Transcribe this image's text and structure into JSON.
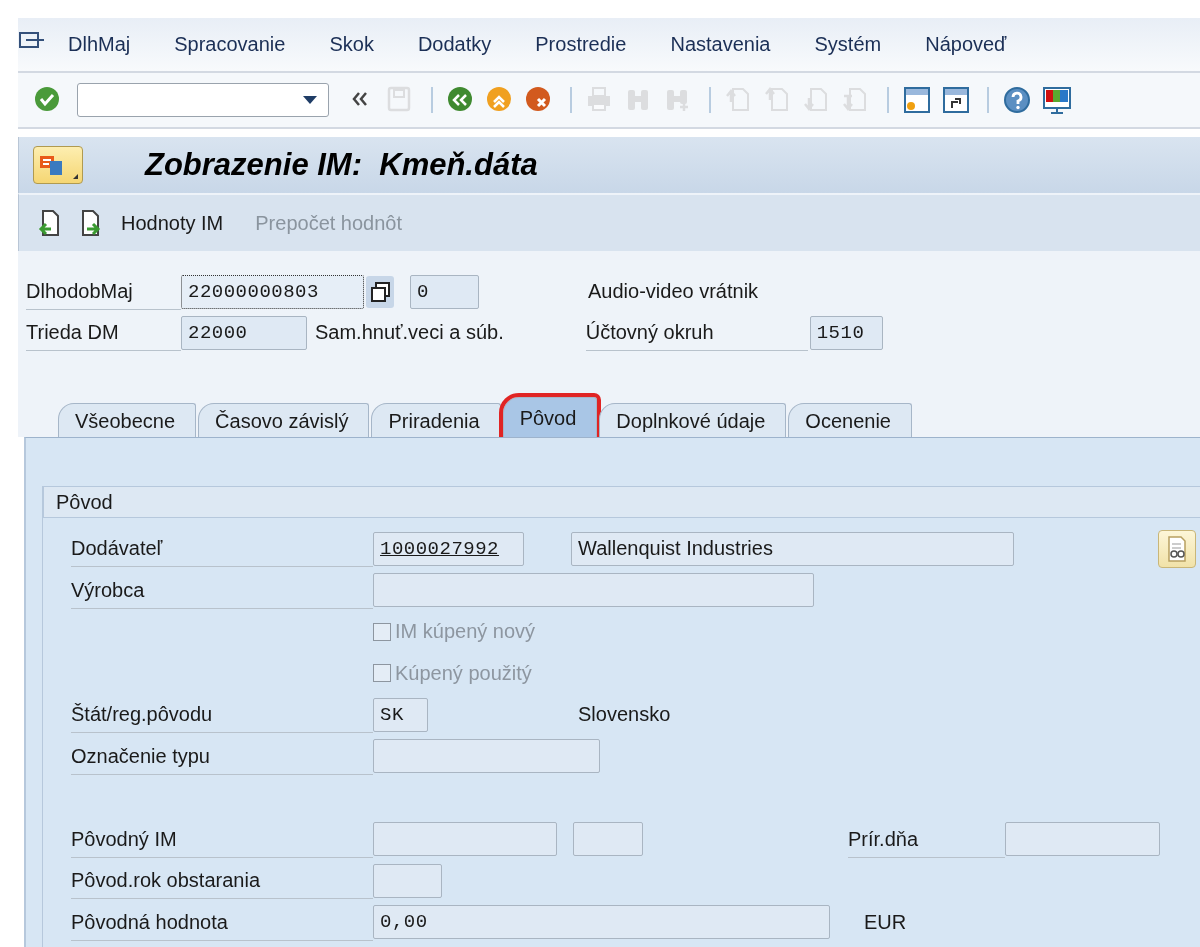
{
  "menu_bar": {
    "items": [
      {
        "label": "DlhMaj"
      },
      {
        "label": "Spracovanie"
      },
      {
        "label": "Skok"
      },
      {
        "label": "Dodatky"
      },
      {
        "label": "Prostredie"
      },
      {
        "label": "Nastavenia"
      },
      {
        "label": "Systém"
      },
      {
        "label": "Nápoveď"
      }
    ]
  },
  "toolbar": {
    "buttons": [
      {
        "kind": "enter",
        "disabled": false
      },
      {
        "kind": "command_field"
      },
      {
        "kind": "collapse",
        "disabled": false
      },
      {
        "kind": "save",
        "disabled": true
      },
      {
        "kind": "separator"
      },
      {
        "kind": "back",
        "disabled": false
      },
      {
        "kind": "exit",
        "disabled": false
      },
      {
        "kind": "cancel",
        "disabled": false
      },
      {
        "kind": "separator"
      },
      {
        "kind": "print",
        "disabled": true
      },
      {
        "kind": "find",
        "disabled": true
      },
      {
        "kind": "find_next",
        "disabled": true
      },
      {
        "kind": "separator"
      },
      {
        "kind": "first_page",
        "disabled": true
      },
      {
        "kind": "previous_page",
        "disabled": true
      },
      {
        "kind": "next_page",
        "disabled": true
      },
      {
        "kind": "last_page",
        "disabled": true
      },
      {
        "kind": "separator"
      },
      {
        "kind": "new_session",
        "disabled": false
      },
      {
        "kind": "shortcut",
        "disabled": false
      },
      {
        "kind": "separator"
      },
      {
        "kind": "help",
        "disabled": false
      },
      {
        "kind": "layout",
        "disabled": false
      }
    ]
  },
  "window": {
    "title": "Zobrazenie IM:  Kmeň.dáta"
  },
  "app_toolbar": {
    "buttons": [
      {
        "kind": "icon_previous",
        "disabled": false
      },
      {
        "kind": "icon_next",
        "disabled": false
      },
      {
        "kind": "text",
        "label": "Hodnoty IM",
        "disabled": false
      },
      {
        "kind": "text",
        "label": "Prepočet hodnôt",
        "disabled": true
      }
    ]
  },
  "header": {
    "rows": [
      {
        "items": [
          {
            "kind": "label",
            "text": "DlhodobMaj"
          },
          {
            "kind": "input",
            "value": "22000000803",
            "focused": true
          },
          {
            "kind": "copy_button"
          },
          {
            "kind": "input",
            "value": "0",
            "focused": false
          },
          {
            "kind": "text",
            "text": "Audio-video vrátnik"
          }
        ]
      },
      {
        "items": [
          {
            "kind": "label",
            "text": "Trieda DM"
          },
          {
            "kind": "input",
            "value": "22000",
            "focused": false
          },
          {
            "kind": "text",
            "text": "Sam.hnuť.veci a súb."
          },
          {
            "kind": "label",
            "text": "Účtovný okruh"
          },
          {
            "kind": "input",
            "value": "1510",
            "focused": false
          }
        ]
      }
    ]
  },
  "tabs": [
    {
      "label": "Všeobecne",
      "selected": false,
      "highlighted": false
    },
    {
      "label": "Časovo závislý",
      "selected": false,
      "highlighted": false
    },
    {
      "label": "Priradenia",
      "selected": false,
      "highlighted": false
    },
    {
      "label": "Pôvod",
      "selected": true,
      "highlighted": true
    },
    {
      "label": "Doplnkové údaje",
      "selected": false,
      "highlighted": false
    },
    {
      "label": "Ocenenie",
      "selected": false,
      "highlighted": false
    }
  ],
  "group": {
    "title": "Pôvod",
    "rows": [
      {
        "items": [
          {
            "kind": "label",
            "text": "Dodávateľ"
          },
          {
            "kind": "input",
            "value": "1000027992",
            "link": true
          },
          {
            "kind": "input",
            "value": "Wallenquist Industries",
            "link": false
          },
          {
            "kind": "detail_button"
          }
        ]
      },
      {
        "items": [
          {
            "kind": "label",
            "text": "Výrobca"
          },
          {
            "kind": "input"
          }
        ]
      },
      {
        "items": [
          {
            "kind": "checkbox",
            "text": "IM kúpený nový",
            "checked": false,
            "disabled": true
          }
        ]
      },
      {
        "items": [
          {
            "kind": "checkbox",
            "text": "Kúpený použitý",
            "checked": false,
            "disabled": true
          }
        ]
      },
      {
        "items": [
          {
            "kind": "label",
            "text": "Štát/reg.pôvodu"
          },
          {
            "kind": "input",
            "value": "SK",
            "link": false
          },
          {
            "kind": "text",
            "text": "Slovensko"
          }
        ]
      },
      {
        "items": [
          {
            "kind": "label",
            "text": "Označenie typu"
          },
          {
            "kind": "input"
          }
        ]
      },
      {
        "items": []
      },
      {
        "items": [
          {
            "kind": "label",
            "text": "Pôvodný IM"
          },
          {
            "kind": "input"
          },
          {
            "kind": "input"
          },
          {
            "kind": "label",
            "text": "Prír.dňa"
          },
          {
            "kind": "input"
          }
        ]
      },
      {
        "items": [
          {
            "kind": "label",
            "text": "Pôvod.rok obstarania"
          },
          {
            "kind": "input"
          }
        ]
      },
      {
        "items": [
          {
            "kind": "label",
            "text": "Pôvodná hodnota"
          },
          {
            "kind": "input",
            "value": "0,00",
            "link": false
          },
          {
            "kind": "text",
            "text": "EUR"
          }
        ]
      }
    ]
  }
}
